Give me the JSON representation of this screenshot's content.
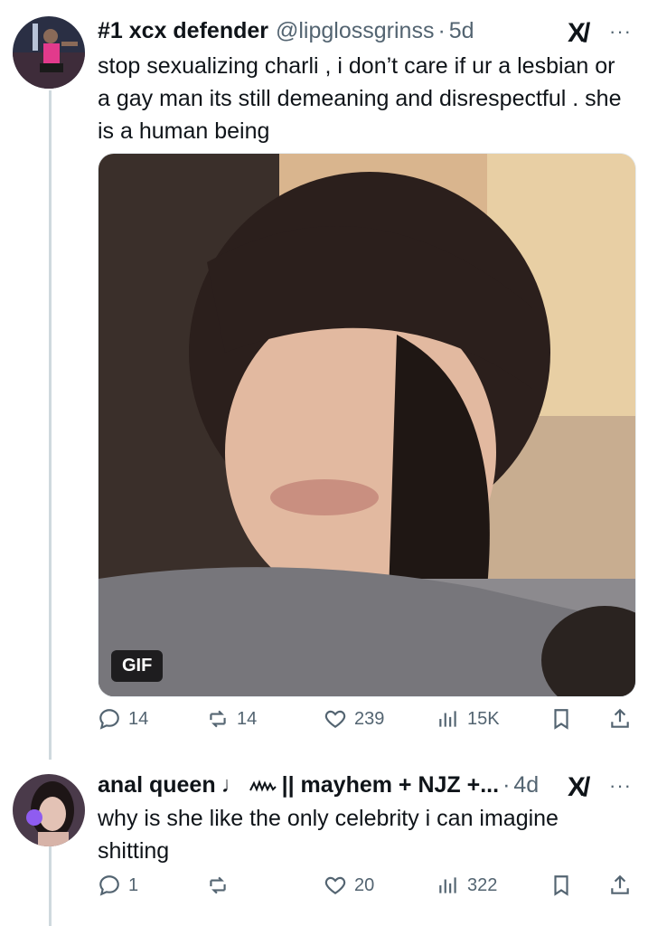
{
  "tweets": [
    {
      "name": "#1 xcx defender",
      "handle": "@lipglossgrinss",
      "time": "5d",
      "text": "stop sexualizing charli , i don’t care if ur a lesbian or a gay man its still demeaning and disrespectful . she is a human being",
      "media_badge": "GIF",
      "replies": "14",
      "reposts": "14",
      "likes": "239",
      "views": "15K"
    },
    {
      "name": "anal queen",
      "name_music": "♩",
      "name_rest": "|| mayhem + NJZ +...",
      "time": "4d",
      "text": "why is she like the only celebrity i can imagine shitting",
      "replies": "1",
      "reposts": "",
      "likes": "20",
      "views": "322"
    }
  ],
  "dot_separator": "·",
  "more_glyph": "···",
  "grok_glyph": "X/",
  "icons": {
    "reply": "reply-icon",
    "repost": "repost-icon",
    "like": "like-icon",
    "views": "views-icon",
    "bookmark": "bookmark-icon",
    "share": "share-icon"
  },
  "colors": {
    "text": "#0f1419",
    "muted": "#536471",
    "thread_line": "#cfd9de"
  }
}
